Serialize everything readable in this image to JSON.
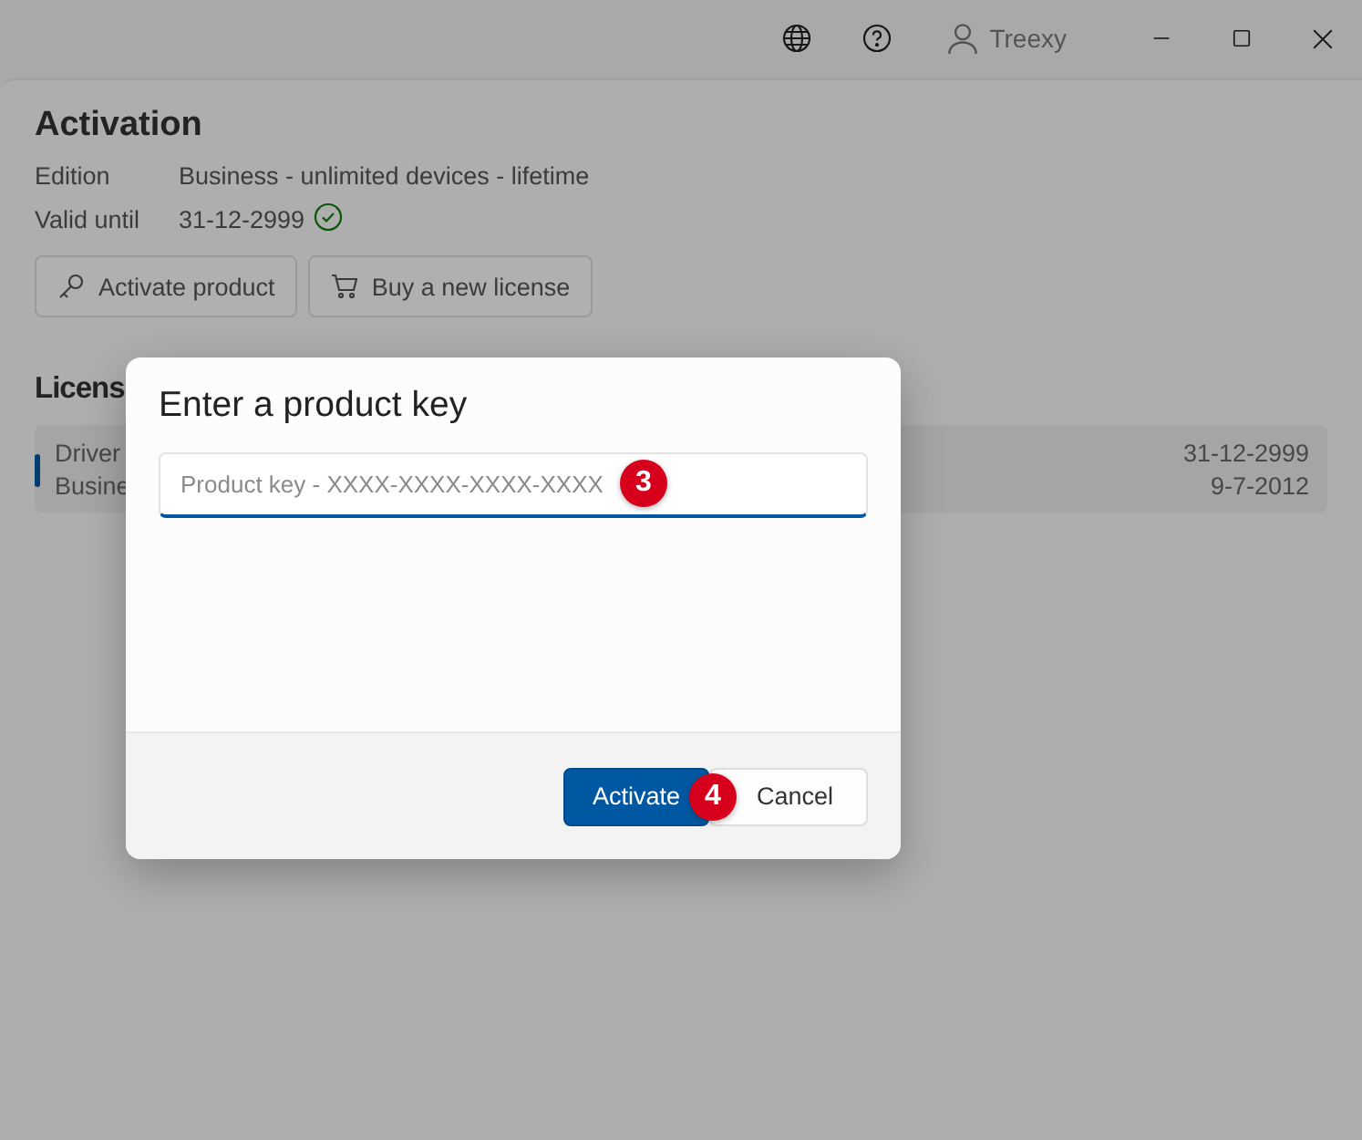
{
  "window": {
    "user": "Treexy"
  },
  "activation": {
    "title": "Activation",
    "fields": [
      {
        "label": "Edition",
        "value": "Business - unlimited devices - lifetime",
        "verified": false
      },
      {
        "label": "Valid until",
        "value": "31-12-2999",
        "verified": true
      }
    ],
    "buttons": [
      {
        "label": "Activate product",
        "kind": "key"
      },
      {
        "label": "Buy a new license",
        "kind": "cart"
      }
    ]
  },
  "licenses": {
    "title": "Licens",
    "rows": [
      {
        "name": "Driver",
        "edition": "Busine",
        "valid_until": "31-12-2999",
        "date": "9-7-2012",
        "selected": true
      }
    ]
  },
  "dialog": {
    "title": "Enter a product key",
    "input": {
      "placeholder": "Product key - XXXX-XXXX-XXXX-XXXX",
      "focused": true,
      "marker": "3"
    },
    "buttons": [
      {
        "label": "Activate",
        "kind": "primary",
        "marker": "4"
      },
      {
        "label": "Cancel",
        "kind": "secondary"
      }
    ]
  }
}
